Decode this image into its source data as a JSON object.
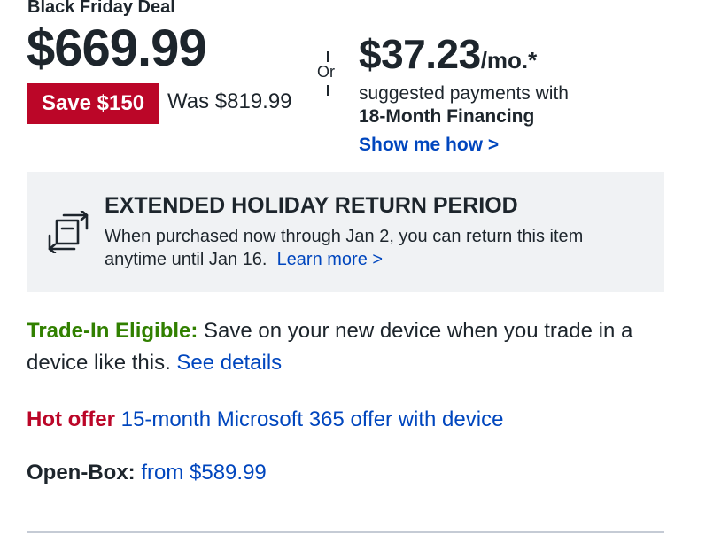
{
  "deal": {
    "label": "Black Friday Deal",
    "price": "$669.99",
    "save_badge": "Save $150",
    "was_price": "Was $819.99"
  },
  "financing": {
    "or_text": "Or",
    "monthly_amount": "$37.23",
    "monthly_suffix": "/mo.*",
    "line1": "suggested payments with",
    "line2": "18-Month Financing",
    "show_me_how": "Show me how >"
  },
  "returns": {
    "icon": "return-exchange-icon",
    "title": "EXTENDED HOLIDAY RETURN PERIOD",
    "body": "When purchased now through Jan 2, you can return this item anytime until Jan 16.",
    "link": "Learn more >"
  },
  "trade_in": {
    "label": "Trade-In Eligible:",
    "text": "Save on your new device when you trade in a device like this.",
    "link": "See details"
  },
  "hot_offer": {
    "label": "Hot offer",
    "link": "15-month Microsoft 365 offer with device"
  },
  "open_box": {
    "label": "Open-Box:",
    "link": "from $589.99"
  },
  "colors": {
    "sale_red": "#bb0628",
    "link_blue": "#0046be",
    "trade_green": "#318000",
    "panel_gray": "#f0f2f4",
    "text_dark": "#1d252c"
  }
}
